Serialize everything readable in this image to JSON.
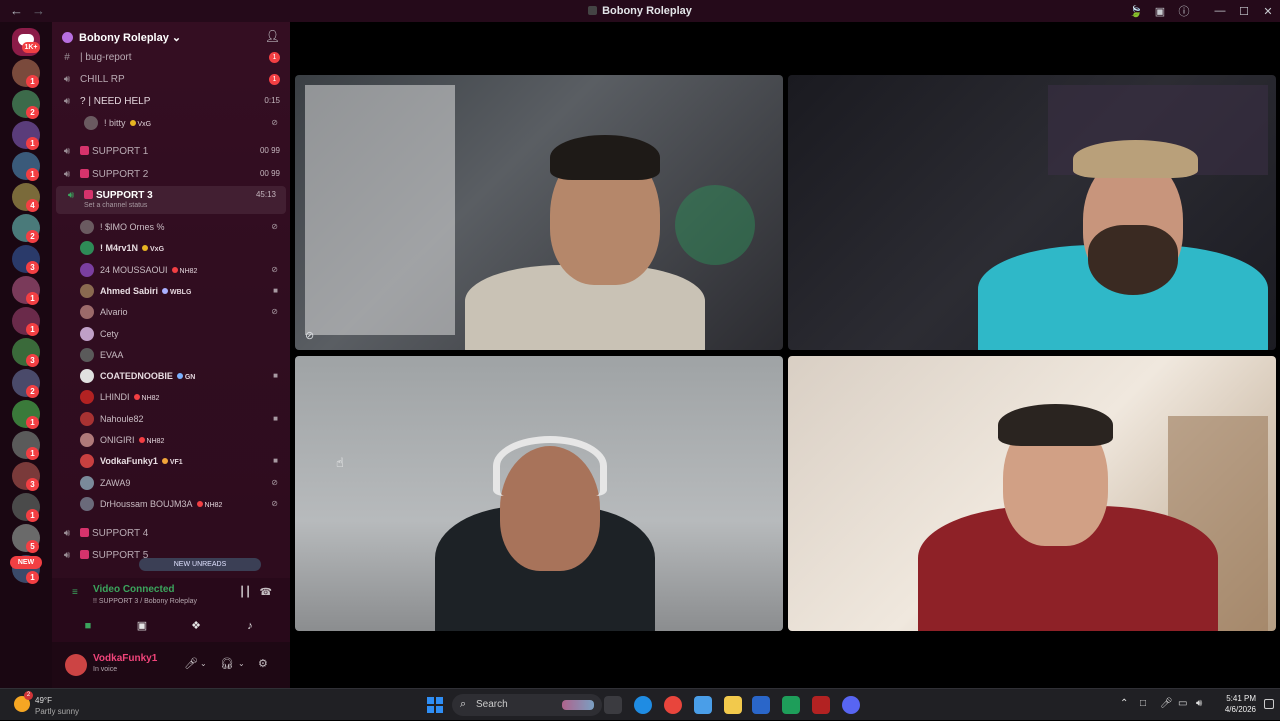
{
  "window": {
    "title": "Bobony Roleplay",
    "back_icon": "←",
    "forward_icon": "→",
    "controls": [
      "—",
      "☐",
      "✕"
    ]
  },
  "rail": {
    "home_badge": "1K+",
    "new_label": "NEW",
    "badges": [
      "1",
      "2",
      "1",
      "1",
      "4",
      "2",
      "3",
      "1",
      "1",
      "3",
      "2",
      "1",
      "1",
      "3",
      "1",
      "5",
      "1"
    ]
  },
  "server": {
    "name": "Bobony Roleplay",
    "chevron": "⌄",
    "add_member_icon": "person-add-icon"
  },
  "channels": {
    "bug_report": {
      "label": "| bug-report",
      "badge": "1"
    },
    "chill_rp": {
      "label": "CHILL RP",
      "badge": "1"
    },
    "need_help": {
      "label": "| NEED HELP",
      "timer": "0:15"
    },
    "support1": {
      "label": "SUPPORT 1",
      "right": "00  99"
    },
    "support2": {
      "label": "SUPPORT 2",
      "right": "00  99"
    },
    "support3": {
      "label": "SUPPORT 3",
      "timer": "45:13",
      "status": "Set a channel status"
    },
    "support4": {
      "label": "SUPPORT 4"
    },
    "support5": {
      "label": "SUPPORT 5"
    }
  },
  "need_help_user": {
    "name": "! bitty",
    "tag": "VxG"
  },
  "voice_users": [
    {
      "name": "! $IMO Ornes %",
      "tag": "",
      "icon": "⊘"
    },
    {
      "name": "! M4rv1N",
      "tag": "VxG",
      "icon": ""
    },
    {
      "name": "24 MOUSSAOUI",
      "tag": "NH82",
      "icon": "⊘"
    },
    {
      "name": "Ahmed Sabiri",
      "tag": "WBLG",
      "icon": "■"
    },
    {
      "name": "Alvario",
      "tag": "",
      "icon": "⊘"
    },
    {
      "name": "Cety",
      "tag": "",
      "icon": ""
    },
    {
      "name": "EVAA",
      "tag": "",
      "icon": ""
    },
    {
      "name": "COATEDNOOBIE",
      "tag": "GN",
      "icon": "■"
    },
    {
      "name": "LHINDI",
      "tag": "NH82",
      "icon": ""
    },
    {
      "name": "Nahoule82",
      "tag": "",
      "icon": "■"
    },
    {
      "name": "ONIGIRI",
      "tag": "NH82",
      "icon": ""
    },
    {
      "name": "VodkaFunky1",
      "tag": "VF1",
      "icon": "■"
    },
    {
      "name": "ZAWA9",
      "tag": "",
      "icon": "⊘"
    },
    {
      "name": "DrHoussam BOUJM3A",
      "tag": "NH82",
      "icon": "⊘"
    }
  ],
  "new_unreads": "NEW UNREADS",
  "voice_panel": {
    "status": "Video Connected",
    "location": "!! SUPPORT 3 / Bobony Roleplay",
    "buttons": [
      "camera-icon",
      "screen-share-icon",
      "activities-icon",
      "soundboard-icon"
    ]
  },
  "user_panel": {
    "username": "VodkaFunky1",
    "status": "In voice"
  },
  "taskbar": {
    "temperature": "49°F",
    "condition": "Partly sunny",
    "weather_badge": "2",
    "search_placeholder": "Search",
    "time": "5:41 PM",
    "date": "4/6/2026"
  },
  "colors": {
    "accent_green": "#3ba55d",
    "sidebar_bg": "#2c0d1e",
    "badge_red": "#f23f43",
    "username_pink": "#f0447a"
  }
}
